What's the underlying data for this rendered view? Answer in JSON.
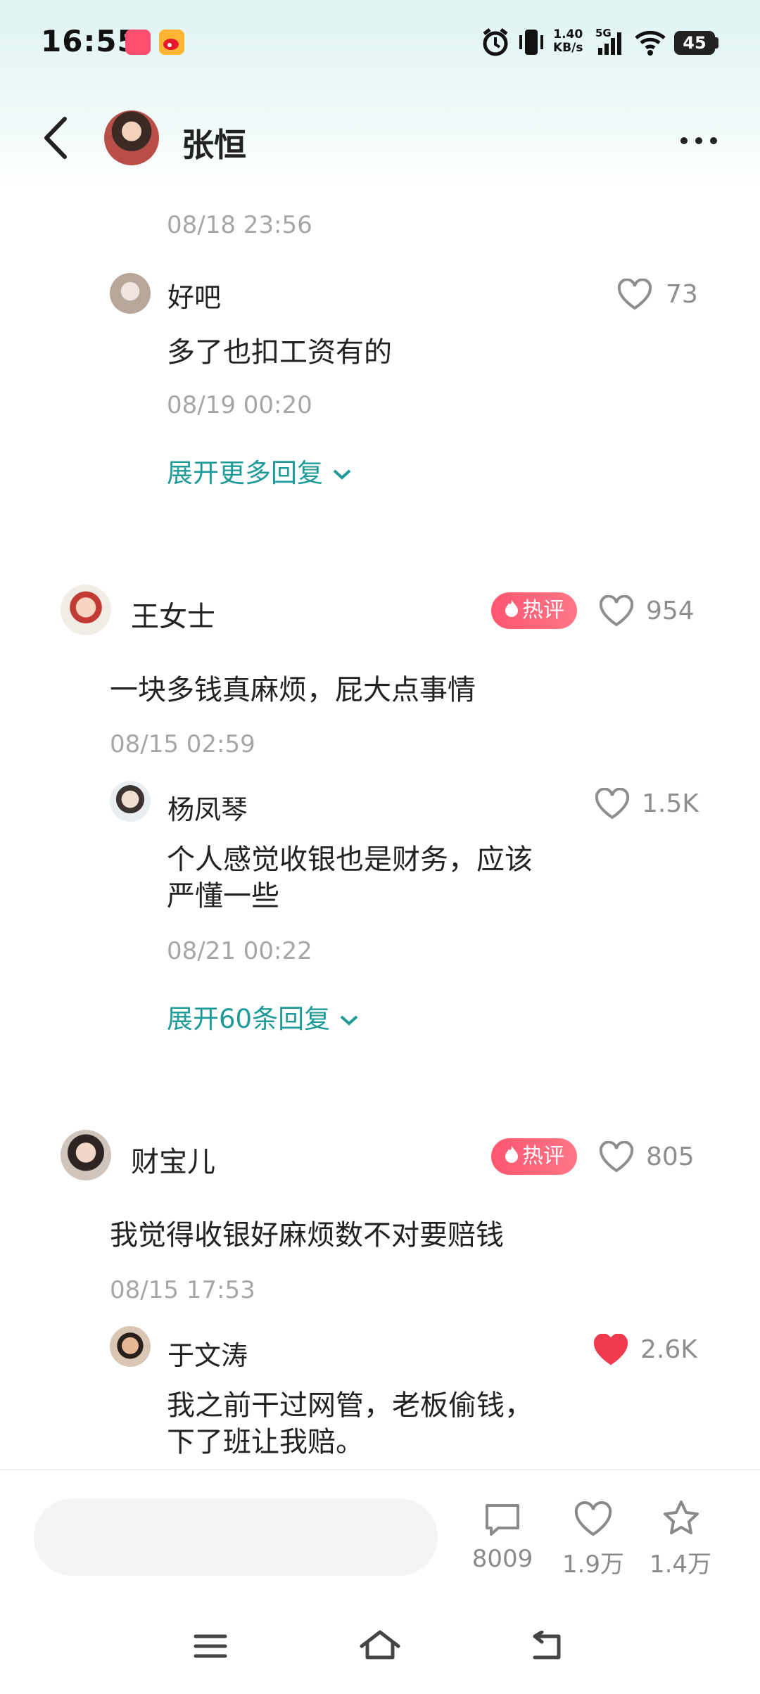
{
  "status_bar": {
    "time": "16:55",
    "speed_top": "1.40",
    "speed_unit": "KB/s",
    "network": "5G",
    "battery": "45"
  },
  "header": {
    "name": "张恒"
  },
  "thread_top": {
    "time": "08/18 23:56"
  },
  "reply_a": {
    "name": "好吧",
    "text": "多了也扣工资有的",
    "time": "08/19 00:20",
    "likes": "73"
  },
  "expand_1": "展开更多回复",
  "comment_1": {
    "name": "王女士",
    "badge": "热评",
    "likes": "954",
    "text": "一块多钱真麻烦，屁大点事情",
    "time": "08/15 02:59",
    "reply": {
      "name": "杨凤琴",
      "likes": "1.5K",
      "text_line1": "个人感觉收银也是财务，应该",
      "text_line2": "严懂一些",
      "time": "08/21 00:22"
    },
    "expand": "展开60条回复"
  },
  "comment_2": {
    "name": "财宝儿",
    "badge": "热评",
    "likes": "805",
    "text": "我觉得收银好麻烦数不对要赔钱",
    "time": "08/15 17:53",
    "reply": {
      "name": "于文涛",
      "likes": "2.6K",
      "liked": true,
      "text_line1": "我之前干过网管，老板偷钱，",
      "text_line2": "下了班让我赔。"
    }
  },
  "bottom_bar": {
    "comments": "8009",
    "likes": "1.9万",
    "favorites": "1.4万"
  },
  "colors": {
    "accent": "#1e9b98",
    "hot_badge": "#ff5571",
    "liked_heart": "#f23a4f"
  }
}
